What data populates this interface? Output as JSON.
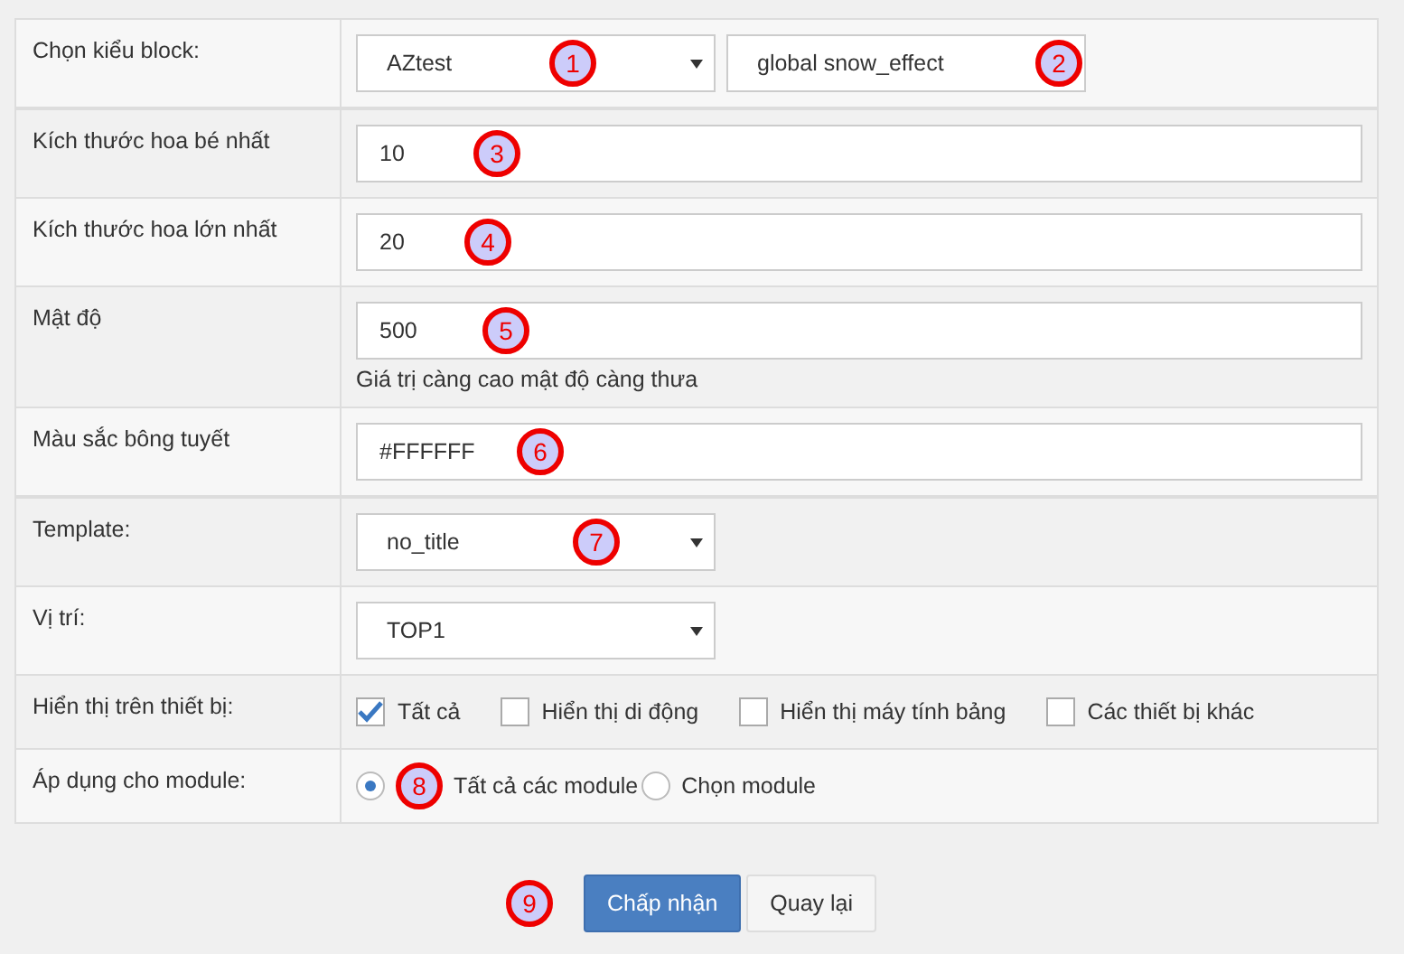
{
  "rows": [
    {
      "label": "Chọn kiểu block:",
      "kind": "selects",
      "selects": [
        {
          "value": "AZtest",
          "marker": "1"
        },
        {
          "value": "global snow_effect",
          "marker": "2"
        }
      ]
    },
    {
      "label": "Kích thước hoa bé nhất",
      "kind": "input",
      "value": "10",
      "marker": "3"
    },
    {
      "label": "Kích thước hoa lớn nhất",
      "kind": "input",
      "value": "20",
      "marker": "4"
    },
    {
      "label": "Mật độ",
      "kind": "input",
      "value": "500",
      "marker": "5",
      "help": "Giá trị càng cao mật độ càng thưa"
    },
    {
      "label": "Màu sắc bông tuyết",
      "kind": "input",
      "value": "#FFFFFF",
      "marker": "6"
    },
    {
      "label": "Template:",
      "kind": "selects",
      "selects": [
        {
          "value": "no_title",
          "marker": "7"
        }
      ]
    },
    {
      "label": "Vị trí:",
      "kind": "selects",
      "selects": [
        {
          "value": "TOP1"
        }
      ]
    },
    {
      "label": "Hiển thị trên thiết bị:",
      "kind": "checkboxes",
      "options": [
        {
          "label": "Tất cả",
          "checked": true
        },
        {
          "label": "Hiển thị di động",
          "checked": false
        },
        {
          "label": "Hiển thị máy tính bảng",
          "checked": false
        },
        {
          "label": "Các thiết bị khác",
          "checked": false
        }
      ]
    },
    {
      "label": "Áp dụng cho module:",
      "kind": "radios",
      "options": [
        {
          "label": "Tất cả các module",
          "selected": true,
          "marker": "8"
        },
        {
          "label": "Chọn module",
          "selected": false
        }
      ]
    }
  ],
  "buttons": [
    {
      "label": "Chấp nhận",
      "kind": "primary"
    },
    {
      "label": "Quay lại",
      "kind": "default"
    }
  ],
  "buttons_marker": "9"
}
